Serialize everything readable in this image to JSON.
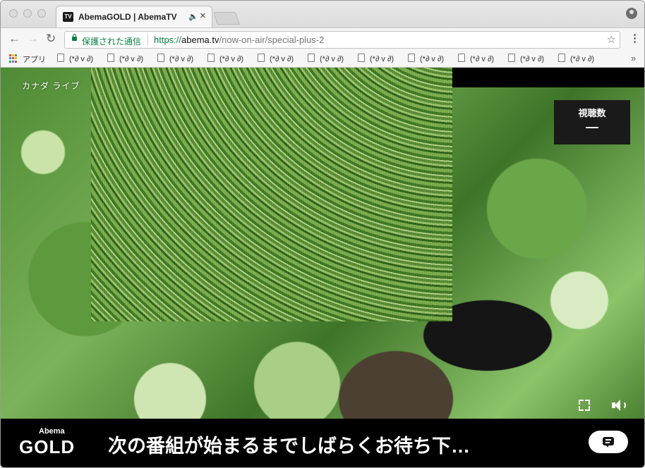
{
  "browser": {
    "tab": {
      "favicon_text": "TV",
      "title": "AbemaGOLD | AbemaTV",
      "audio_icon": "🔈",
      "close_icon": "×"
    },
    "toolbar": {
      "back_icon": "←",
      "forward_icon": "→",
      "reload_icon": "↻",
      "secure_label": "保護された通信",
      "url_scheme": "https://",
      "url_host": "abema.tv",
      "url_path": "/now-on-air/special-plus-2",
      "star_icon": "☆",
      "menu_icon": "⋮"
    },
    "bookmarks": {
      "apps_label": "アプリ",
      "apps_colors": [
        "#e94235",
        "#fbbc05",
        "#34a853",
        "#4285f4",
        "#e94235",
        "#fbbc05",
        "#34a853",
        "#4285f4",
        "#e94235"
      ],
      "items": [
        "(*∂ v ∂)",
        "(*∂ v ∂)",
        "(*∂ v ∂)",
        "(*∂ v ∂)",
        "(*∂ v ∂)",
        "(*∂ v ∂)",
        "(*∂ v ∂)",
        "(*∂ v ∂)",
        "(*∂ v ∂)",
        "(*∂ v ∂)",
        "(*∂ v ∂)"
      ],
      "more_icon": "»"
    }
  },
  "player": {
    "caption": "カナダ ライブ",
    "viewer_label": "視聴数",
    "viewer_count": "—",
    "fullscreen_icon": "fullscreen-icon",
    "volume_icon": "volume-icon"
  },
  "footer": {
    "logo_small": "Abema",
    "logo_big": "GOLD",
    "message": "次の番組が始まるまでしばらくお待ち下…",
    "chat_icon": "chat-icon"
  }
}
